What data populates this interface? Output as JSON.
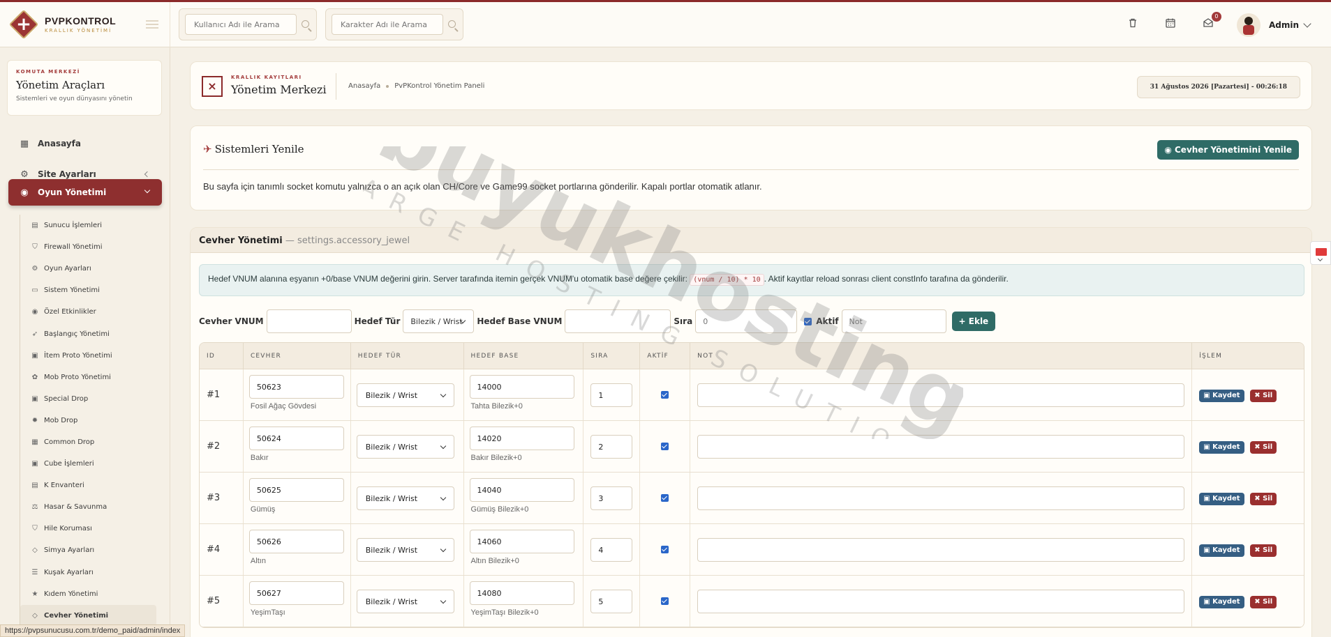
{
  "brand": {
    "title": "PVPKONTROL",
    "subtitle": "KRALLIK YÖNETİMİ"
  },
  "search": {
    "user_placeholder": "Kullanıcı Adı ile Arama",
    "char_placeholder": "Karakter Adı ile Arama"
  },
  "topbar": {
    "mail_badge": "0",
    "admin_name": "Admin"
  },
  "sidebar": {
    "kicker": "KOMUTA MERKEZİ",
    "title": "Yönetim Araçları",
    "subtitle": "Sistemleri ve oyun dünyasını yönetin",
    "items": [
      {
        "label": "Anasayfa",
        "icon": "dashboard-icon"
      },
      {
        "label": "Site Ayarları",
        "icon": "gear-icon"
      },
      {
        "label": "Oyun Yönetimi",
        "icon": "gamepad-icon"
      }
    ],
    "sub_items": [
      {
        "label": "Sunucu İşlemleri",
        "icon": "server-icon"
      },
      {
        "label": "Firewall Yönetimi",
        "icon": "shield-icon"
      },
      {
        "label": "Oyun Ayarları",
        "icon": "gears-icon"
      },
      {
        "label": "Sistem Yönetimi",
        "icon": "monitor-icon"
      },
      {
        "label": "Özel Etkinlikler",
        "icon": "gamepad-icon"
      },
      {
        "label": "Başlangıç Yönetimi",
        "icon": "rocket-icon"
      },
      {
        "label": "İtem Proto Yönetimi",
        "icon": "box-icon"
      },
      {
        "label": "Mob Proto Yönetimi",
        "icon": "paw-icon"
      },
      {
        "label": "Special Drop",
        "icon": "box-icon"
      },
      {
        "label": "Mob Drop",
        "icon": "bug-icon"
      },
      {
        "label": "Common Drop",
        "icon": "table-icon"
      },
      {
        "label": "Cube İşlemleri",
        "icon": "cube-icon"
      },
      {
        "label": "K Envanteri",
        "icon": "inventory-icon"
      },
      {
        "label": "Hasar & Savunma",
        "icon": "scale-icon"
      },
      {
        "label": "Hile Koruması",
        "icon": "shield-icon"
      },
      {
        "label": "Simya Ayarları",
        "icon": "gem-icon"
      },
      {
        "label": "Kuşak Ayarları",
        "icon": "sliders-icon"
      },
      {
        "label": "Kıdem Yönetimi",
        "icon": "star-icon"
      },
      {
        "label": "Cevher Yönetimi",
        "icon": "gem-icon"
      }
    ]
  },
  "crumb": {
    "kicker": "KRALLIK KAYITLARI",
    "title": "Yönetim Merkezi",
    "bc_home": "Anasayfa",
    "bc_current": "PvPKontrol Yönetim Paneli",
    "datetime": "31 Ağustos 2026 [Pazartesi] - 00:26:18"
  },
  "refresh": {
    "title": "Sistemleri Yenile",
    "button": "Cevher Yönetimini Yenile",
    "desc": "Bu sayfa için tanımlı socket komutu yalnızca o an açık olan CH/Core ve Game99 socket portlarına gönderilir. Kapalı portlar otomatik atlanır."
  },
  "gem": {
    "title": "Cevher Yönetimi",
    "key": "— settings.accessory_jewel",
    "alert_pre": "Hedef VNUM alanına eşyanın +0/base VNUM değerini girin. Server tarafında itemin gerçek VNUM'u otomatik base değere çekilir:",
    "alert_code": "(vnum / 10) * 10",
    "alert_post": ". Aktif kayıtlar reload sonrası client constInfo tarafına da gönderilir.",
    "form": {
      "vnum_label": "Cevher VNUM",
      "type_label": "Hedef Tür",
      "type_value": "Bilezik / Wrist",
      "base_label": "Hedef Base VNUM",
      "order_label": "Sıra",
      "order_placeholder": "0",
      "active_label": "Aktif",
      "note_placeholder": "Not",
      "add_button": "Ekle"
    },
    "columns": [
      "ID",
      "CEVHER",
      "HEDEF TÜR",
      "HEDEF BASE",
      "SIRA",
      "AKTİF",
      "NOT",
      "İŞLEM"
    ],
    "save_label": "Kaydet",
    "delete_label": "Sil",
    "rows": [
      {
        "id": "#1",
        "vnum": "50623",
        "name": "Fosil Ağaç Gövdesi",
        "type": "Bilezik / Wrist",
        "base": "14000",
        "base_name": "Tahta Bilezik+0",
        "order": "1"
      },
      {
        "id": "#2",
        "vnum": "50624",
        "name": "Bakır",
        "type": "Bilezik / Wrist",
        "base": "14020",
        "base_name": "Bakır Bilezik+0",
        "order": "2"
      },
      {
        "id": "#3",
        "vnum": "50625",
        "name": "Gümüş",
        "type": "Bilezik / Wrist",
        "base": "14040",
        "base_name": "Gümüş Bilezik+0",
        "order": "3"
      },
      {
        "id": "#4",
        "vnum": "50626",
        "name": "Altın",
        "type": "Bilezik / Wrist",
        "base": "14060",
        "base_name": "Altın Bilezik+0",
        "order": "4"
      },
      {
        "id": "#5",
        "vnum": "50627",
        "name": "YeşimTaşı",
        "type": "Bilezik / Wrist",
        "base": "14080",
        "base_name": "YeşimTaşı Bilezik+0",
        "order": "5"
      }
    ]
  },
  "watermark": {
    "main": "buyukhosting",
    "sub": "LARGE HOSTING SOLUTIONS"
  },
  "status_url": "https://pvpsunucusu.com.tr/demo_paid/admin/index",
  "colors": {
    "brand": "#8e2f2f",
    "teal": "#2f6b66",
    "save": "#355e83",
    "delete": "#9a2f2f"
  }
}
